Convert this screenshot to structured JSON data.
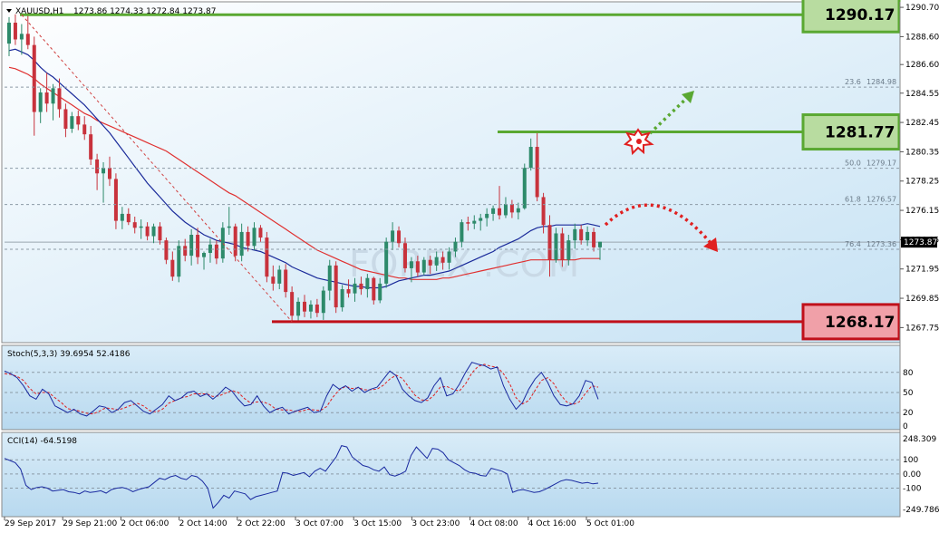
{
  "header": {
    "symbol": "XAUUSD,H1",
    "ohlc": "1273.86 1274.33 1272.84 1273.87"
  },
  "watermark": "FOREX .COM",
  "colors": {
    "bg_top": "#ffffff",
    "bg_bottom": "#c6e2f4",
    "bull": "#2d8a6a",
    "bear": "#c8323c",
    "ma_fast": "#1a2a9a",
    "ma_slow": "#e03030",
    "level_green": "#5aa832",
    "level_red": "#c0101a",
    "box_green": "#b8dca0",
    "box_red": "#f0a0a8"
  },
  "chart_data": [
    {
      "type": "candlestick",
      "title": "XAUUSD,H1",
      "ylim": [
        1266.8,
        1290.9
      ],
      "price_ticks": [
        "1290.70",
        "1288.60",
        "1286.60",
        "1284.55",
        "1282.45",
        "1280.35",
        "1278.25",
        "1276.15",
        "1274.05",
        "1271.95",
        "1269.85",
        "1267.75"
      ],
      "current_price": "1273.87",
      "x_labels": [
        "29 Sep 2017",
        "29 Sep 21:00",
        "2 Oct 06:00",
        "2 Oct 14:00",
        "2 Oct 22:00",
        "3 Oct 07:00",
        "3 Oct 15:00",
        "3 Oct 23:00",
        "4 Oct 08:00",
        "4 Oct 16:00",
        "5 Oct 01:00"
      ],
      "candles": [
        [
          1288.1,
          1290.0,
          1287.2,
          1289.6
        ],
        [
          1289.6,
          1290.2,
          1288.0,
          1288.4
        ],
        [
          1288.4,
          1289.5,
          1287.3,
          1288.8
        ],
        [
          1288.8,
          1290.3,
          1287.7,
          1288.0
        ],
        [
          1288.0,
          1288.6,
          1281.5,
          1283.2
        ],
        [
          1283.2,
          1284.9,
          1282.4,
          1284.6
        ],
        [
          1284.6,
          1286.0,
          1283.2,
          1283.8
        ],
        [
          1283.8,
          1285.2,
          1282.6,
          1284.9
        ],
        [
          1284.9,
          1285.6,
          1282.8,
          1283.4
        ],
        [
          1283.4,
          1283.8,
          1281.4,
          1282.0
        ],
        [
          1282.0,
          1283.2,
          1281.7,
          1282.9
        ],
        [
          1282.9,
          1283.3,
          1281.9,
          1282.3
        ],
        [
          1282.3,
          1282.9,
          1281.2,
          1281.6
        ],
        [
          1281.6,
          1282.2,
          1279.4,
          1279.8
        ],
        [
          1279.8,
          1280.2,
          1277.6,
          1278.8
        ],
        [
          1278.8,
          1279.6,
          1276.7,
          1279.2
        ],
        [
          1279.2,
          1280.0,
          1277.9,
          1278.4
        ],
        [
          1278.4,
          1278.8,
          1274.8,
          1275.4
        ],
        [
          1275.4,
          1276.4,
          1274.8,
          1275.9
        ],
        [
          1275.9,
          1276.3,
          1275.1,
          1275.3
        ],
        [
          1275.3,
          1275.7,
          1274.5,
          1274.9
        ],
        [
          1274.9,
          1275.5,
          1274.1,
          1275.0
        ],
        [
          1275.0,
          1275.3,
          1274.0,
          1274.3
        ],
        [
          1274.3,
          1275.2,
          1273.8,
          1275.0
        ],
        [
          1275.0,
          1275.3,
          1273.7,
          1274.0
        ],
        [
          1274.0,
          1274.2,
          1272.3,
          1272.6
        ],
        [
          1272.6,
          1273.2,
          1271.1,
          1271.4
        ],
        [
          1271.4,
          1274.0,
          1271.0,
          1273.6
        ],
        [
          1273.6,
          1274.1,
          1272.5,
          1272.9
        ],
        [
          1272.9,
          1274.8,
          1272.2,
          1274.4
        ],
        [
          1274.4,
          1274.9,
          1272.3,
          1272.8
        ],
        [
          1272.8,
          1273.2,
          1271.9,
          1273.1
        ],
        [
          1273.1,
          1274.1,
          1272.4,
          1273.7
        ],
        [
          1273.7,
          1274.0,
          1272.3,
          1272.7
        ],
        [
          1272.7,
          1275.3,
          1272.4,
          1274.9
        ],
        [
          1274.9,
          1276.4,
          1274.4,
          1275.0
        ],
        [
          1275.0,
          1275.2,
          1272.5,
          1272.9
        ],
        [
          1272.9,
          1275.2,
          1272.5,
          1274.6
        ],
        [
          1274.6,
          1275.0,
          1273.2,
          1273.6
        ],
        [
          1273.6,
          1275.3,
          1273.3,
          1274.9
        ],
        [
          1274.9,
          1275.1,
          1273.9,
          1274.2
        ],
        [
          1274.2,
          1274.6,
          1271.0,
          1271.4
        ],
        [
          1271.4,
          1272.2,
          1270.4,
          1270.9
        ],
        [
          1270.9,
          1272.2,
          1270.5,
          1271.9
        ],
        [
          1271.9,
          1272.3,
          1269.9,
          1270.3
        ],
        [
          1270.3,
          1270.7,
          1268.2,
          1268.6
        ],
        [
          1268.6,
          1269.9,
          1268.1,
          1269.6
        ],
        [
          1269.6,
          1270.1,
          1268.5,
          1268.9
        ],
        [
          1268.9,
          1269.7,
          1268.4,
          1269.4
        ],
        [
          1269.4,
          1269.8,
          1268.5,
          1268.8
        ],
        [
          1268.8,
          1270.7,
          1268.3,
          1270.4
        ],
        [
          1270.4,
          1272.6,
          1269.7,
          1272.2
        ],
        [
          1272.2,
          1272.5,
          1268.8,
          1269.2
        ],
        [
          1269.2,
          1270.8,
          1268.9,
          1270.5
        ],
        [
          1270.5,
          1271.2,
          1269.9,
          1270.2
        ],
        [
          1270.2,
          1271.3,
          1269.6,
          1270.9
        ],
        [
          1270.9,
          1271.4,
          1270.1,
          1270.5
        ],
        [
          1270.5,
          1271.6,
          1269.9,
          1271.3
        ],
        [
          1271.3,
          1271.4,
          1269.4,
          1269.7
        ],
        [
          1269.7,
          1271.3,
          1269.5,
          1270.9
        ],
        [
          1270.9,
          1274.2,
          1270.6,
          1273.9
        ],
        [
          1273.9,
          1275.3,
          1273.3,
          1274.7
        ],
        [
          1274.7,
          1275.0,
          1273.5,
          1273.8
        ],
        [
          1273.8,
          1274.2,
          1271.7,
          1272.0
        ],
        [
          1272.0,
          1272.8,
          1271.0,
          1272.5
        ],
        [
          1272.5,
          1272.9,
          1271.4,
          1271.7
        ],
        [
          1271.7,
          1272.8,
          1271.5,
          1272.6
        ],
        [
          1272.6,
          1272.9,
          1271.6,
          1272.2
        ],
        [
          1272.2,
          1273.2,
          1271.8,
          1272.8
        ],
        [
          1272.8,
          1273.2,
          1271.9,
          1272.4
        ],
        [
          1272.4,
          1273.5,
          1271.9,
          1273.2
        ],
        [
          1273.2,
          1274.2,
          1272.8,
          1273.9
        ],
        [
          1273.9,
          1275.5,
          1273.5,
          1275.3
        ],
        [
          1275.3,
          1275.7,
          1274.7,
          1275.2
        ],
        [
          1275.2,
          1275.8,
          1274.8,
          1275.4
        ],
        [
          1275.4,
          1275.9,
          1274.7,
          1275.6
        ],
        [
          1275.6,
          1276.3,
          1275.0,
          1275.9
        ],
        [
          1275.9,
          1276.5,
          1275.4,
          1276.3
        ],
        [
          1276.3,
          1277.9,
          1275.5,
          1275.8
        ],
        [
          1275.8,
          1277.1,
          1275.6,
          1276.6
        ],
        [
          1276.6,
          1276.9,
          1275.6,
          1276.0
        ],
        [
          1276.0,
          1276.7,
          1275.5,
          1276.3
        ],
        [
          1276.3,
          1279.5,
          1276.2,
          1279.2
        ],
        [
          1279.2,
          1281.3,
          1279.0,
          1280.7
        ],
        [
          1280.7,
          1281.8,
          1276.8,
          1277.1
        ],
        [
          1277.1,
          1277.4,
          1274.5,
          1275.1
        ],
        [
          1275.1,
          1275.8,
          1271.4,
          1272.6
        ],
        [
          1272.6,
          1274.9,
          1272.4,
          1274.5
        ],
        [
          1274.5,
          1274.9,
          1272.1,
          1272.6
        ],
        [
          1272.6,
          1274.4,
          1272.2,
          1274.0
        ],
        [
          1274.0,
          1275.2,
          1273.4,
          1274.8
        ],
        [
          1274.8,
          1275.1,
          1273.7,
          1274.0
        ],
        [
          1274.0,
          1275.0,
          1273.6,
          1274.6
        ],
        [
          1274.6,
          1274.9,
          1273.2,
          1273.5
        ],
        [
          1273.5,
          1273.9,
          1272.6,
          1273.9
        ]
      ],
      "ma_fast": [
        1287.6,
        1287.7,
        1287.5,
        1287.3,
        1286.9,
        1286.4,
        1286.0,
        1285.7,
        1285.3,
        1284.9,
        1284.5,
        1284.1,
        1283.7,
        1283.2,
        1282.7,
        1282.2,
        1281.7,
        1281.1,
        1280.5,
        1279.9,
        1279.3,
        1278.7,
        1278.1,
        1277.6,
        1277.1,
        1276.6,
        1276.1,
        1275.7,
        1275.3,
        1275.0,
        1274.7,
        1274.4,
        1274.2,
        1274.0,
        1273.9,
        1273.8,
        1273.7,
        1273.5,
        1273.4,
        1273.3,
        1273.2,
        1273.0,
        1272.8,
        1272.6,
        1272.4,
        1272.1,
        1271.9,
        1271.7,
        1271.5,
        1271.3,
        1271.2,
        1271.1,
        1271.0,
        1270.9,
        1270.8,
        1270.7,
        1270.7,
        1270.6,
        1270.6,
        1270.6,
        1270.7,
        1270.9,
        1271.1,
        1271.2,
        1271.3,
        1271.4,
        1271.5,
        1271.5,
        1271.6,
        1271.7,
        1271.8,
        1272.0,
        1272.2,
        1272.4,
        1272.6,
        1272.8,
        1273.0,
        1273.2,
        1273.5,
        1273.7,
        1273.9,
        1274.1,
        1274.4,
        1274.7,
        1274.9,
        1275.0,
        1275.0,
        1275.1,
        1275.1,
        1275.1,
        1275.1,
        1275.1,
        1275.2,
        1275.1,
        1275.0
      ],
      "ma_slow": [
        1286.4,
        1286.3,
        1286.1,
        1285.9,
        1285.6,
        1285.2,
        1284.9,
        1284.6,
        1284.3,
        1284.0,
        1283.7,
        1283.4,
        1283.1,
        1282.9,
        1282.6,
        1282.4,
        1282.2,
        1282.0,
        1281.8,
        1281.6,
        1281.4,
        1281.2,
        1281.0,
        1280.8,
        1280.6,
        1280.4,
        1280.1,
        1279.8,
        1279.5,
        1279.2,
        1278.9,
        1278.6,
        1278.3,
        1278.0,
        1277.7,
        1277.4,
        1277.2,
        1276.9,
        1276.6,
        1276.3,
        1276.0,
        1275.7,
        1275.4,
        1275.1,
        1274.8,
        1274.5,
        1274.2,
        1273.9,
        1273.6,
        1273.3,
        1273.1,
        1272.9,
        1272.7,
        1272.5,
        1272.3,
        1272.1,
        1271.9,
        1271.8,
        1271.7,
        1271.6,
        1271.5,
        1271.4,
        1271.3,
        1271.3,
        1271.2,
        1271.2,
        1271.2,
        1271.2,
        1271.2,
        1271.3,
        1271.3,
        1271.4,
        1271.5,
        1271.6,
        1271.7,
        1271.8,
        1271.9,
        1272.0,
        1272.1,
        1272.2,
        1272.3,
        1272.4,
        1272.5,
        1272.6,
        1272.6,
        1272.6,
        1272.6,
        1272.6,
        1272.6,
        1272.6,
        1272.6,
        1272.7,
        1272.7,
        1272.7,
        1272.7
      ],
      "fib_levels": [
        {
          "label": "23.6",
          "price": "1284.98",
          "value": 1284.98
        },
        {
          "label": "50.0",
          "price": "1279.17",
          "value": 1279.17
        },
        {
          "label": "61.8",
          "price": "1276.57",
          "value": 1276.57
        },
        {
          "label": "76.4",
          "price": "1273.36",
          "value": 1273.36
        }
      ],
      "key_levels": [
        {
          "value": 1290.17,
          "text": "1290.17",
          "kind": "resistance"
        },
        {
          "value": 1281.77,
          "text": "1281.77",
          "kind": "resistance"
        },
        {
          "value": 1268.17,
          "text": "1268.17",
          "kind": "support"
        }
      ]
    },
    {
      "type": "line",
      "title": "Stoch(5,3,3) 39.6954 52.4186",
      "ylim": [
        0,
        100
      ],
      "ticks": [
        "80",
        "50",
        "20",
        "0"
      ],
      "main": [
        82,
        78,
        72,
        60,
        45,
        40,
        55,
        48,
        30,
        25,
        20,
        25,
        18,
        15,
        22,
        30,
        28,
        20,
        25,
        35,
        38,
        30,
        22,
        18,
        25,
        32,
        45,
        38,
        42,
        50,
        52,
        44,
        48,
        40,
        48,
        58,
        52,
        40,
        30,
        32,
        45,
        30,
        20,
        25,
        28,
        18,
        22,
        25,
        28,
        20,
        22,
        45,
        62,
        55,
        60,
        52,
        58,
        50,
        55,
        58,
        70,
        82,
        75,
        55,
        45,
        38,
        35,
        42,
        60,
        72,
        45,
        48,
        62,
        80,
        95,
        92,
        90,
        85,
        88,
        60,
        40,
        25,
        35,
        55,
        70,
        80,
        65,
        45,
        32,
        30,
        33,
        45,
        68,
        65,
        40
      ],
      "signal": [
        78,
        77,
        74,
        68,
        56,
        48,
        50,
        50,
        42,
        35,
        26,
        24,
        22,
        19,
        18,
        22,
        27,
        26,
        24,
        27,
        31,
        34,
        30,
        23,
        21,
        25,
        34,
        38,
        42,
        44,
        48,
        48,
        48,
        44,
        45,
        49,
        53,
        50,
        41,
        34,
        36,
        36,
        32,
        25,
        24,
        24,
        22,
        22,
        25,
        24,
        23,
        29,
        43,
        54,
        59,
        56,
        57,
        54,
        54,
        55,
        61,
        70,
        76,
        71,
        58,
        46,
        39,
        38,
        46,
        58,
        59,
        55,
        52,
        63,
        79,
        89,
        92,
        89,
        88,
        78,
        63,
        42,
        33,
        38,
        53,
        68,
        72,
        63,
        47,
        36,
        32,
        36,
        49,
        60,
        58
      ]
    },
    {
      "type": "line",
      "title": "CCI(14) -64.5198",
      "ylim": [
        -249.786,
        248.309
      ],
      "ticks": [
        "248.309",
        "100",
        "0.00",
        "-100",
        "-249.786"
      ],
      "values": [
        110,
        95,
        80,
        35,
        -80,
        -110,
        -95,
        -90,
        -100,
        -120,
        -115,
        -110,
        -125,
        -130,
        -140,
        -120,
        -130,
        -125,
        -118,
        -135,
        -110,
        -100,
        -95,
        -105,
        -125,
        -110,
        -100,
        -90,
        -60,
        -30,
        -40,
        -20,
        -10,
        -30,
        -40,
        -10,
        -20,
        -50,
        -100,
        -240,
        -200,
        -150,
        -170,
        -120,
        -130,
        -140,
        -180,
        -160,
        -150,
        -140,
        -130,
        -120,
        10,
        5,
        -10,
        0,
        10,
        -20,
        20,
        40,
        20,
        70,
        120,
        200,
        190,
        120,
        90,
        60,
        50,
        30,
        20,
        50,
        -5,
        -15,
        0,
        20,
        130,
        190,
        150,
        110,
        180,
        175,
        150,
        100,
        80,
        60,
        30,
        10,
        5,
        -10,
        -15,
        40,
        30,
        20,
        0,
        -130,
        -115,
        -110,
        -120,
        -130,
        -125,
        -110,
        -90,
        -70,
        -50,
        -40,
        -45,
        -55,
        -65,
        -60,
        -70,
        -64.5
      ]
    }
  ]
}
